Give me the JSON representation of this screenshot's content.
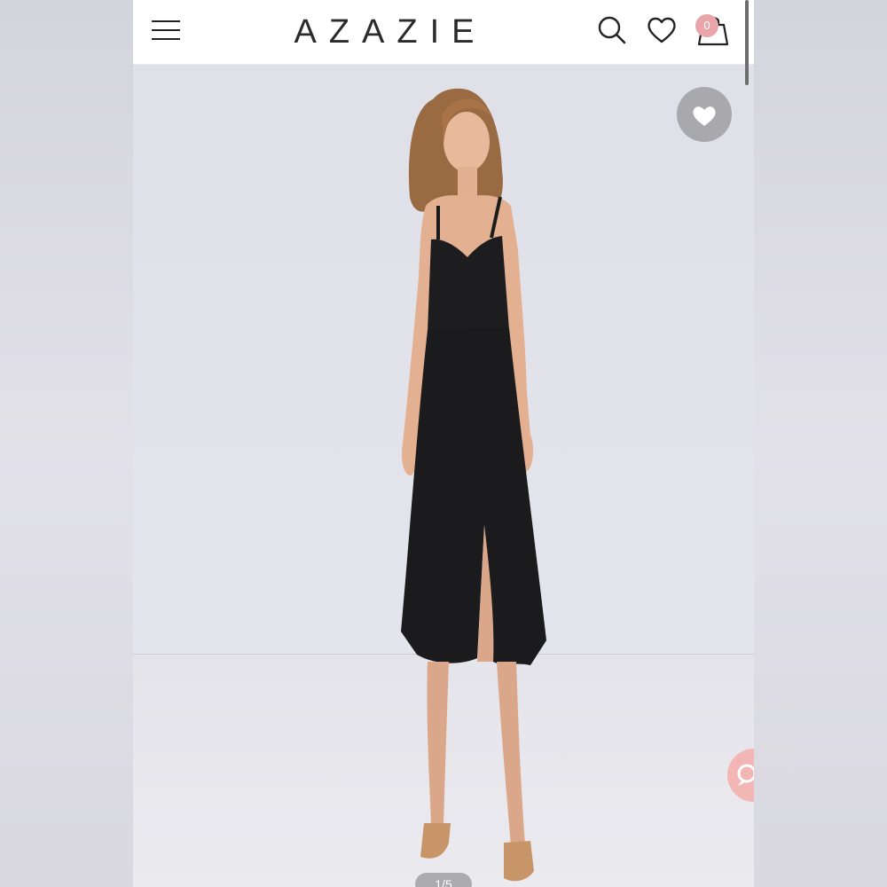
{
  "header": {
    "logo": "AZAZIE",
    "cart_count": "0"
  },
  "icons": {
    "menu": "hamburger-menu-icon",
    "search": "search-icon",
    "wishlist": "heart-icon",
    "cart": "shopping-bag-icon",
    "favorite": "heart-icon",
    "chat": "chat-icon"
  },
  "gallery": {
    "counter": "1/5"
  },
  "colors": {
    "brand_text": "#2b2b2b",
    "badge": "#e8a6ab",
    "chat_button": "#f2b6b4"
  }
}
